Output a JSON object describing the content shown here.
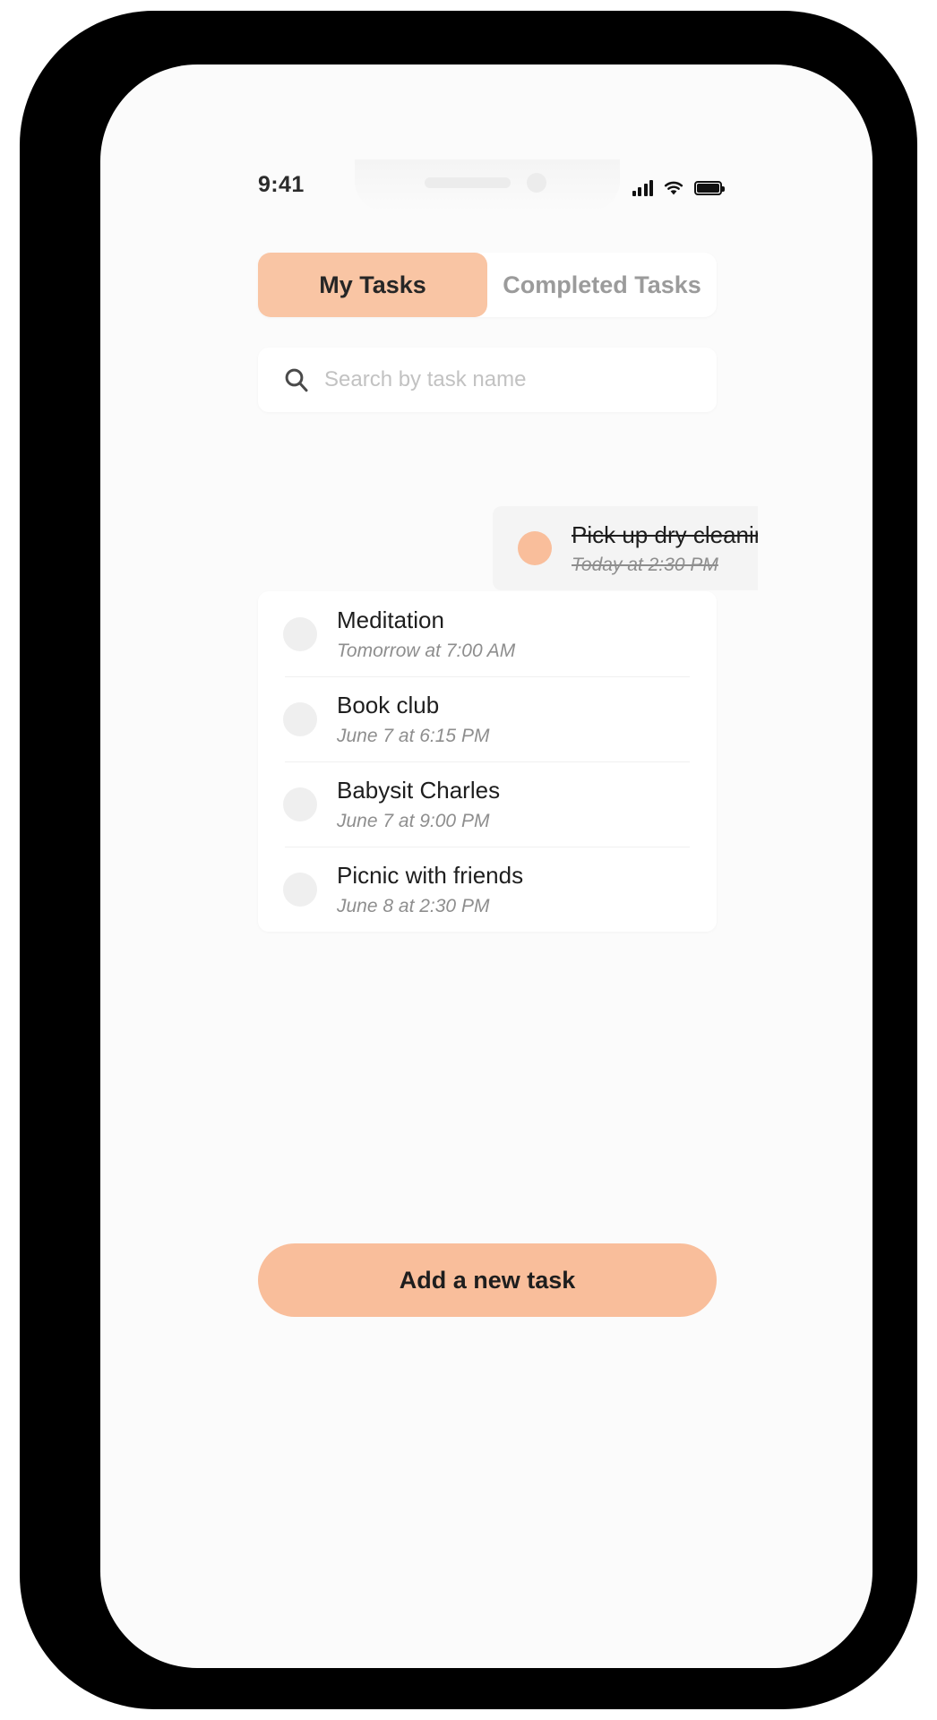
{
  "status_bar": {
    "time": "9:41",
    "signal_icon": "signal-bars-icon",
    "wifi_icon": "wifi-icon",
    "battery_icon": "battery-full-icon"
  },
  "tabs": [
    {
      "label": "My Tasks",
      "active": true
    },
    {
      "label": "Completed Tasks",
      "active": false
    }
  ],
  "search": {
    "placeholder": "Search by task name",
    "value": "",
    "icon": "search-icon"
  },
  "dragged_task": {
    "title": "Pick up dry cleaning",
    "subtitle": "Today at 2:30 PM",
    "completed": true
  },
  "tasks": [
    {
      "title": "Meditation",
      "subtitle": "Tomorrow at 7:00 AM"
    },
    {
      "title": "Book club",
      "subtitle": "June 7 at 6:15 PM"
    },
    {
      "title": "Babysit Charles",
      "subtitle": "June 7 at 9:00 PM"
    },
    {
      "title": "Picnic with friends",
      "subtitle": "June 8 at 2:30 PM"
    }
  ],
  "add_button": {
    "label": "Add a new task"
  },
  "colors": {
    "accent": "#F9BE9B",
    "accent_tab": "#F9C5A4",
    "screen_bg": "#FBFBFB",
    "card_bg": "#FFFFFF",
    "text_primary": "#1E1E1E",
    "text_muted": "#8E8E8E",
    "tab_inactive": "#9B9B9B"
  }
}
